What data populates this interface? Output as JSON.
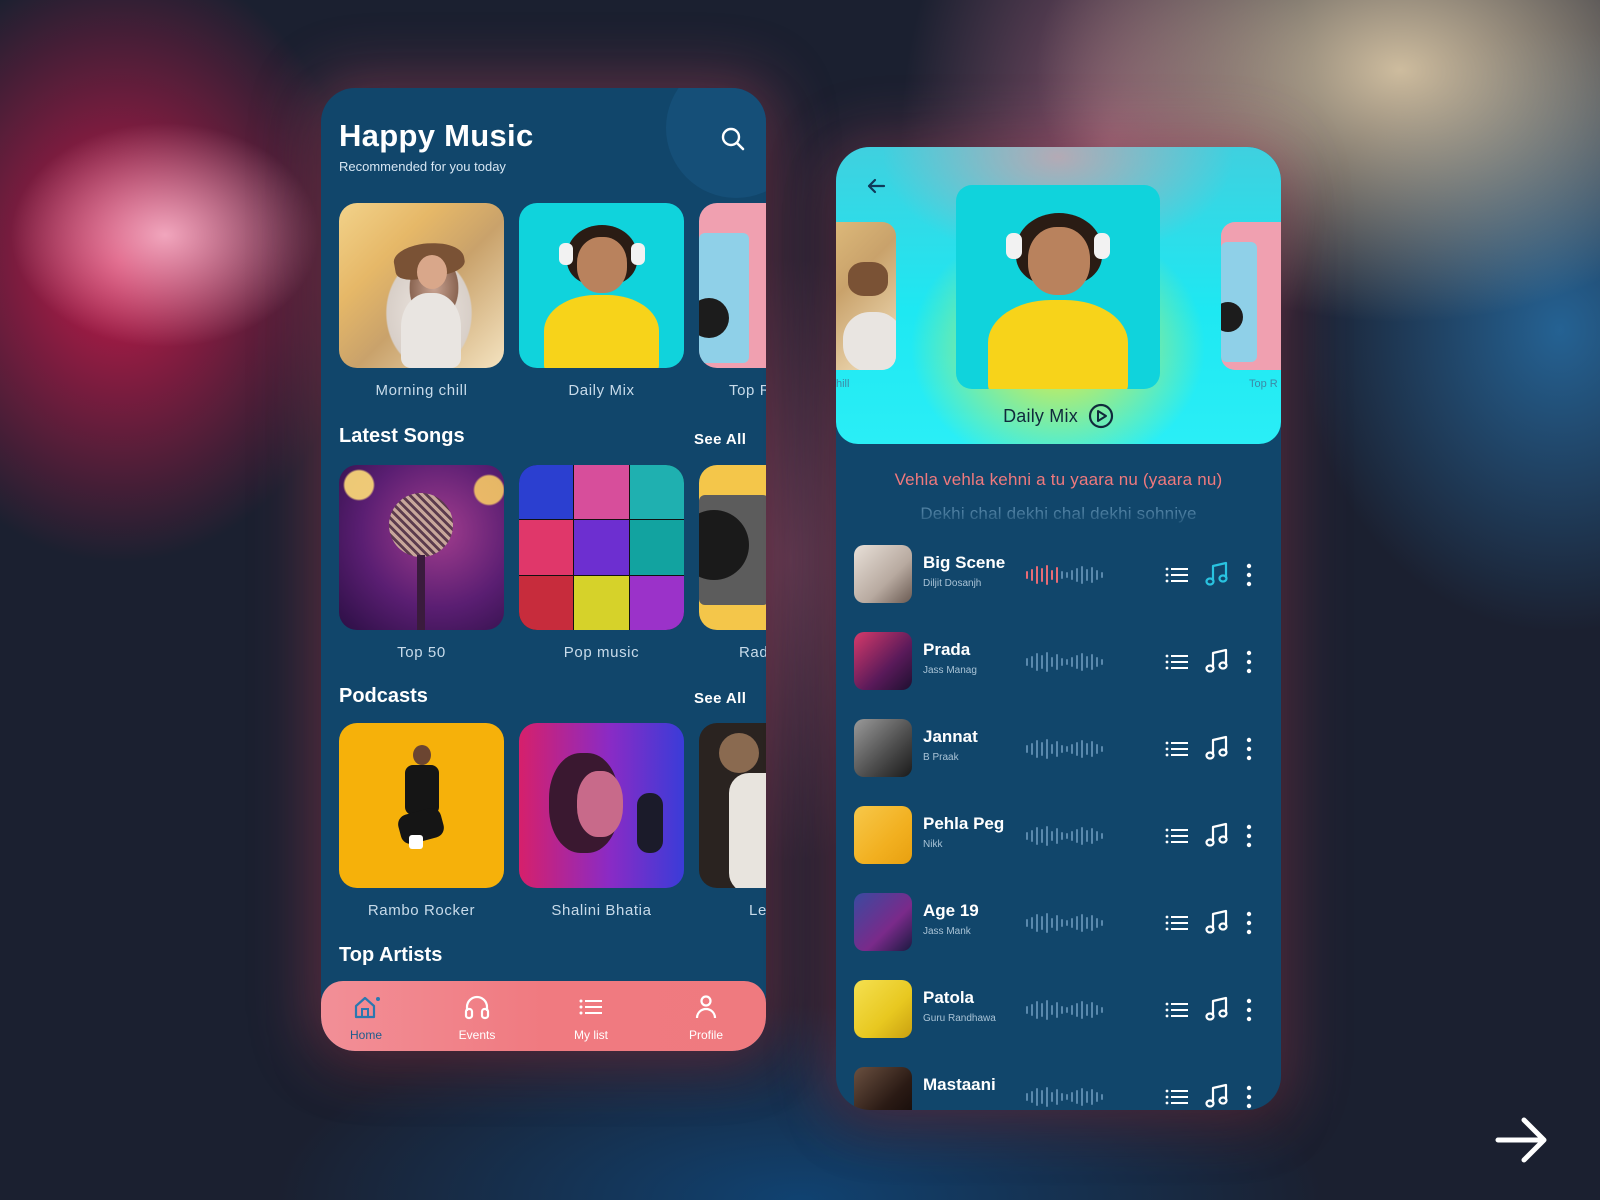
{
  "home": {
    "title": "Happy Music",
    "subtitle": "Recommended for you today",
    "featured": [
      {
        "label": "Morning chill"
      },
      {
        "label": "Daily Mix"
      },
      {
        "label": "Top R"
      }
    ],
    "latest_songs": {
      "title": "Latest Songs",
      "see_all": "See All",
      "items": [
        {
          "label": "Top 50"
        },
        {
          "label": "Pop music"
        },
        {
          "label": "Rad"
        }
      ]
    },
    "podcasts": {
      "title": "Podcasts",
      "see_all": "See All",
      "items": [
        {
          "label": "Rambo Rocker"
        },
        {
          "label": "Shalini Bhatia"
        },
        {
          "label": "Let"
        }
      ]
    },
    "top_artists": {
      "title": "Top Artists"
    },
    "nav": [
      {
        "label": "Home",
        "icon": "home-icon",
        "active": true
      },
      {
        "label": "Events",
        "icon": "headphones-icon",
        "active": false
      },
      {
        "label": "My list",
        "icon": "list-icon",
        "active": false
      },
      {
        "label": "Profile",
        "icon": "profile-icon",
        "active": false
      }
    ]
  },
  "player": {
    "current": "Daily Mix",
    "left_label": "hill",
    "right_label": "Top R",
    "lyrics": [
      "Vehla vehla kehni a tu yaara nu (yaara nu)",
      "Dekhi chal dekhi chal dekhi sohniye"
    ],
    "songs": [
      {
        "title": "Big Scene",
        "artist": "Diljit Dosanjh",
        "playing": true
      },
      {
        "title": "Prada",
        "artist": "Jass Manag",
        "playing": false
      },
      {
        "title": "Jannat",
        "artist": "B Praak",
        "playing": false
      },
      {
        "title": "Pehla Peg",
        "artist": "Nikk",
        "playing": false
      },
      {
        "title": "Age 19",
        "artist": "Jass Mank",
        "playing": false
      },
      {
        "title": "Patola",
        "artist": "Guru Randhawa",
        "playing": false
      },
      {
        "title": "Mastaani",
        "artist": "",
        "playing": false
      }
    ]
  },
  "colors": {
    "panel": "#11466b",
    "accent": "#f07a80",
    "playing_accent": "#29c3e0",
    "nav_active": "#1e5c8c"
  }
}
